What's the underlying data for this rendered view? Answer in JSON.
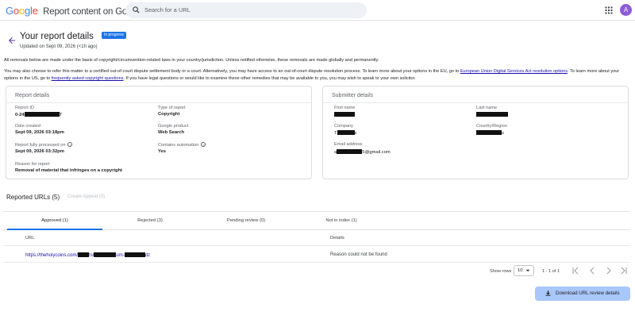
{
  "header": {
    "logo_google": [
      "G",
      "o",
      "o",
      "g",
      "l",
      "e"
    ],
    "product": "Report content on Google",
    "search_placeholder": "Search for a URL",
    "avatar_letter": "A"
  },
  "page": {
    "title": "Your report details",
    "status_badge": "In progress",
    "updated": "Updated on Sept 09, 2026 (<1h ago)"
  },
  "notice": {
    "line1": "All removals below are made under the basis of copyright/circumvention-related laws in your country/jurisdiction. Unless notified otherwise, these removals are made globally and permanently.",
    "line2_a": "You may also choose to refer this matter to a certified out-of-court dispute settlement body or a court. Alternatively, you may have access to an out-of-court dispute resolution process. To learn more about your options in the EU, go to ",
    "link_eu": "European Union Digital Services Act resolution options",
    "line2_b": ". To learn more about your options in the US, go to ",
    "link_faq": "frequently asked copyright questions",
    "line2_c": ". If you have legal questions or would like to examine these other remedies that may be available to you, you may wish to speak to your own solicitor."
  },
  "report": {
    "title": "Report details",
    "id_label": "Report ID",
    "id_prefix": "0-24",
    "id_suffix": "7",
    "type_label": "Type of report",
    "type_value": "Copyright",
    "date_label": "Date created",
    "date_value": "Sept 09, 2026 03:18pm",
    "product_label": "Google product",
    "product_value": "Web Search",
    "processed_label": "Report fully processed on",
    "processed_value": "Sept 09, 2026 03:32pm",
    "automation_label": "Contains automation",
    "automation_value": "Yes",
    "reason_label": "Reason for report",
    "reason_value": "Removal of material that infringes on a copyright"
  },
  "submitter": {
    "title": "Submitter details",
    "first_name_label": "First name",
    "last_name_label": "Last name",
    "company_label": "Company",
    "company_prefix": "T",
    "company_suffix": "s",
    "country_label": "Country/Region",
    "country_suffix": "s",
    "email_label": "Email address",
    "email_prefix": "a",
    "email_suffix": "5@gmail.com"
  },
  "urls": {
    "heading": "Reported URLs (5)",
    "appeal": "Create Appeal (0)",
    "tabs": [
      "Approved (1)",
      "Rejected (3)",
      "Pending review (0)",
      "Not in index (1)"
    ],
    "col_url": "URL",
    "col_details": "Details",
    "row_url_prefix": "https://theholycoins.com/",
    "row_url_mid1": "ts/",
    "row_url_mid2": "um-",
    "row_url_suffix": "dz",
    "row_detail": "Reason could not be found",
    "show_rows_label": "Show rows",
    "rows_value": "10",
    "range": "1 - 1 of 1",
    "download": "Download URL review details"
  },
  "colors": {
    "accent": "#1a73e8",
    "link": "#1a0dab",
    "download_bg": "#a8c7fa"
  },
  "icons": [
    "search-icon",
    "apps-grid-icon",
    "back-arrow-icon",
    "info-icon",
    "chevron-down-icon",
    "first-page-icon",
    "prev-page-icon",
    "next-page-icon",
    "last-page-icon",
    "download-icon"
  ]
}
